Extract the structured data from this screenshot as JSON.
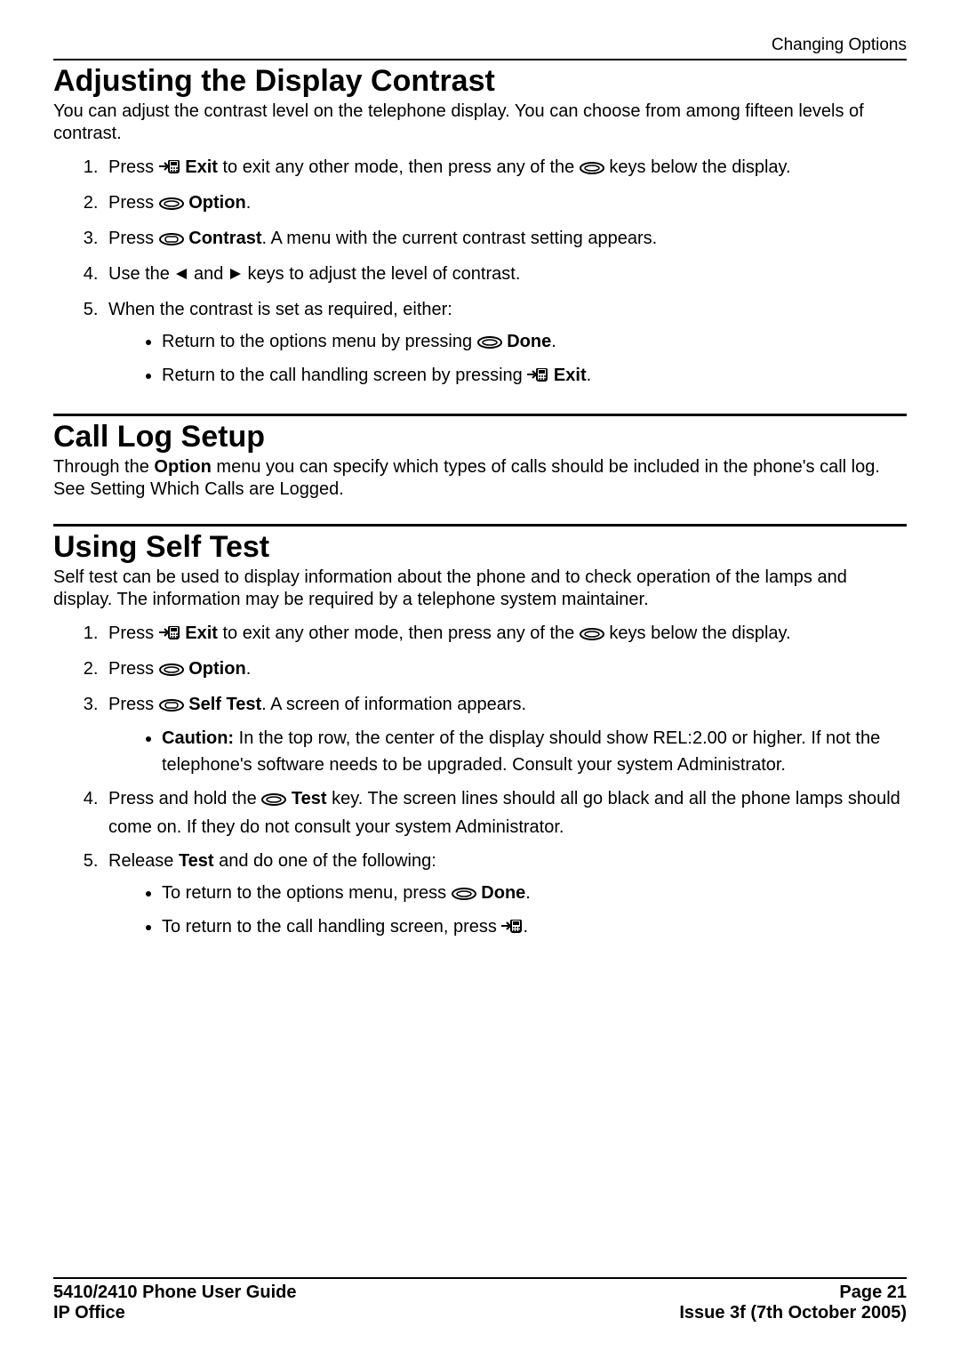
{
  "header": {
    "right": "Changing Options"
  },
  "sec1": {
    "title": "Adjusting the Display Contrast",
    "intro": "You can adjust the contrast level on the telephone display. You can choose from among fifteen levels of contrast.",
    "s1a": "Press ",
    "s1b_bold": "Exit",
    "s1c": " to exit any other mode, then press any of the ",
    "s1d": " keys below the display.",
    "s2a": "Press ",
    "s2b_bold": "Option",
    "s2c": ".",
    "s3a": "Press ",
    "s3b_bold": "Contrast",
    "s3c": ". A menu with the current contrast setting appears.",
    "s4a": "Use the ",
    "s4b": " and ",
    "s4c": " keys to adjust the level of contrast.",
    "s5": "When the contrast is set as required, either:",
    "s5_b1a": "Return to the options menu by pressing ",
    "s5_b1b_bold": "Done",
    "s5_b1c": ".",
    "s5_b2a": "Return to the call handling screen by pressing ",
    "s5_b2b_bold": " Exit",
    "s5_b2c": "."
  },
  "sec2": {
    "title": "Call Log Setup",
    "p_a": "Through the ",
    "p_b_bold": "Option",
    "p_c": " menu you can specify which types of calls should be included in the phone's call log. See Setting Which Calls are Logged."
  },
  "sec3": {
    "title": "Using Self Test",
    "intro": "Self test can be used to display information about the phone and to check operation of the lamps and display. The information may be required by a telephone system maintainer.",
    "s1a": "Press ",
    "s1b_bold": "Exit",
    "s1c": " to exit any other mode, then press any of the ",
    "s1d": " keys below the display.",
    "s2a": "Press ",
    "s2b_bold": "Option",
    "s2c": ".",
    "s3a": "Press ",
    "s3b_bold": "Self Test",
    "s3c": ". A screen of information appears.",
    "s3_b1a_bold": "Caution:",
    "s3_b1b": "  In the top row, the center of the display should show REL:2.00 or higher. If not the telephone's software needs to be upgraded. Consult your system Administrator.",
    "s4a": "Press and hold the ",
    "s4b_bold": "Test",
    "s4c": " key. The screen lines should all go black and all the phone lamps should come on. If they do not consult your system Administrator.",
    "s5a": "Release ",
    "s5b_bold": "Test",
    "s5c": " and do one of the following:",
    "s5_b1a": "To return to the options menu, press ",
    "s5_b1b_bold": "Done",
    "s5_b1c": ".",
    "s5_b2a": "To return to the call handling screen, press ",
    "s5_b2b": "."
  },
  "footer": {
    "left1": "5410/2410 Phone User Guide",
    "right1": "Page 21",
    "left2": "IP Office",
    "right2": "Issue 3f (7th October 2005)"
  }
}
